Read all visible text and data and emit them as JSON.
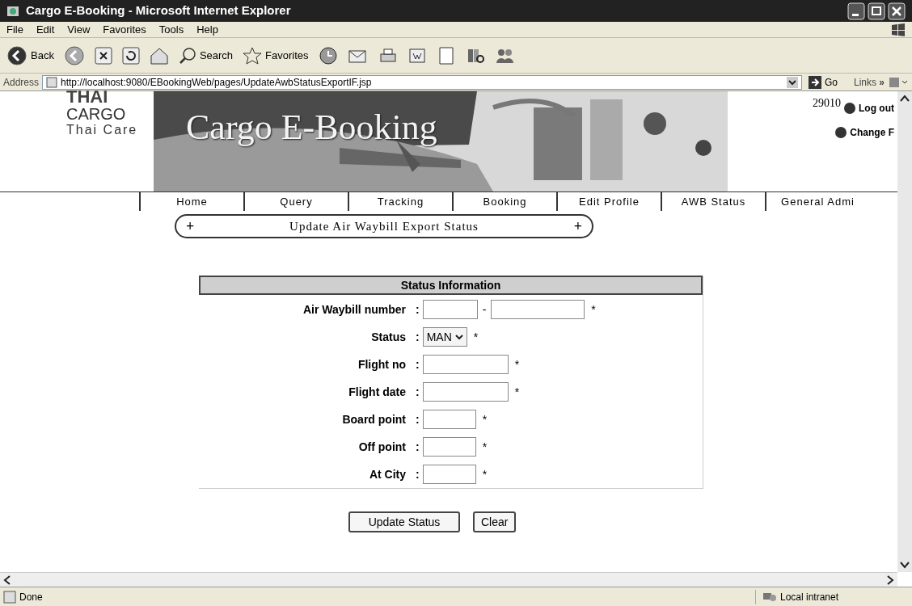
{
  "window": {
    "title": "Cargo E-Booking - Microsoft Internet Explorer"
  },
  "menu": [
    "File",
    "Edit",
    "View",
    "Favorites",
    "Tools",
    "Help"
  ],
  "toolbar": {
    "back": "Back",
    "search": "Search",
    "favorites": "Favorites"
  },
  "address_bar": {
    "label": "Address",
    "url": "http://localhost:9080/EBookingWeb/pages/UpdateAwbStatusExportIF.jsp",
    "go": "Go",
    "links": "Links",
    "chevron": "»"
  },
  "header": {
    "logo": [
      "THAI",
      "CARGO",
      "Thai Care"
    ],
    "banner_title": "Cargo E-Booking",
    "user_id": "29010",
    "links": [
      "Log out",
      "Change F"
    ]
  },
  "nav_tabs": [
    "Home",
    "Query",
    "Tracking",
    "Booking",
    "Edit Profile",
    "AWB Status",
    "General Admi"
  ],
  "page_title": {
    "text": "Update Air Waybill Export Status",
    "left": "+",
    "right": "+"
  },
  "form": {
    "title": "Status Information",
    "fields": [
      {
        "label": "Air Waybill number",
        "kind": "pair",
        "separator": ":",
        "joiner": "-",
        "required": "*"
      },
      {
        "label": "Status",
        "kind": "select",
        "separator": ":",
        "value": "MAN",
        "required": "*"
      },
      {
        "label": "Flight no",
        "kind": "wide",
        "separator": ":",
        "required": "*"
      },
      {
        "label": "Flight date",
        "kind": "wide",
        "separator": ":",
        "required": "*"
      },
      {
        "label": "Board point",
        "kind": "short",
        "separator": ":",
        "required": "*"
      },
      {
        "label": "Off point",
        "kind": "short",
        "separator": ":",
        "required": "*"
      },
      {
        "label": "At City",
        "kind": "short",
        "separator": ":",
        "required": "*"
      }
    ],
    "buttons": [
      "Update Status",
      "Clear"
    ]
  },
  "status_bar": {
    "text": "Done",
    "zone": "Local intranet"
  }
}
